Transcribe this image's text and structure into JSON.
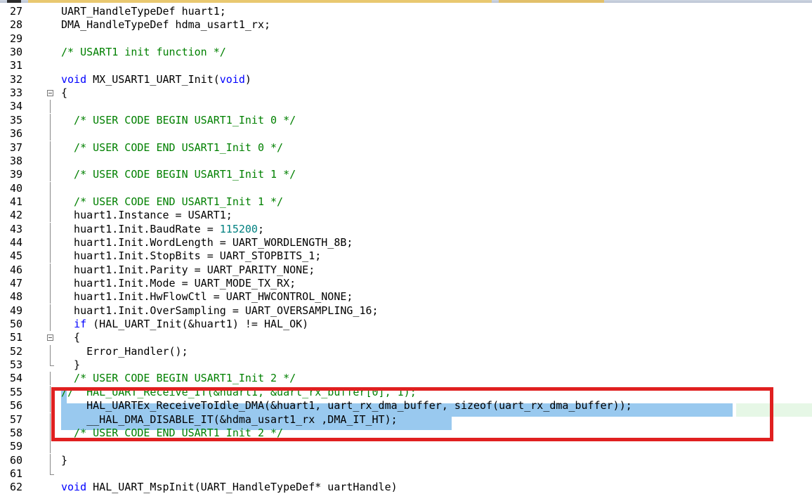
{
  "editor": {
    "lines": [
      {
        "n": "27",
        "parts": [
          {
            "t": "UART_HandleTypeDef huart1;",
            "c": "p"
          }
        ]
      },
      {
        "n": "28",
        "parts": [
          {
            "t": "DMA_HandleTypeDef hdma_usart1_rx;",
            "c": "p"
          }
        ]
      },
      {
        "n": "29",
        "parts": []
      },
      {
        "n": "30",
        "parts": [
          {
            "t": "/* USART1 init function */",
            "c": "cm"
          }
        ]
      },
      {
        "n": "31",
        "parts": []
      },
      {
        "n": "32",
        "parts": [
          {
            "t": "void",
            "c": "kw"
          },
          {
            "t": " MX_USART1_UART_Init(",
            "c": "p"
          },
          {
            "t": "void",
            "c": "kw"
          },
          {
            "t": ")",
            "c": "p"
          }
        ]
      },
      {
        "n": "33",
        "parts": [
          {
            "t": "{",
            "c": "p"
          }
        ]
      },
      {
        "n": "34",
        "parts": []
      },
      {
        "n": "35",
        "parts": [
          {
            "t": "  /* USER CODE BEGIN USART1_Init 0 */",
            "c": "cm"
          }
        ]
      },
      {
        "n": "36",
        "parts": []
      },
      {
        "n": "37",
        "parts": [
          {
            "t": "  /* USER CODE END USART1_Init 0 */",
            "c": "cm"
          }
        ]
      },
      {
        "n": "38",
        "parts": []
      },
      {
        "n": "39",
        "parts": [
          {
            "t": "  /* USER CODE BEGIN USART1_Init 1 */",
            "c": "cm"
          }
        ]
      },
      {
        "n": "40",
        "parts": []
      },
      {
        "n": "41",
        "parts": [
          {
            "t": "  /* USER CODE END USART1_Init 1 */",
            "c": "cm"
          }
        ]
      },
      {
        "n": "42",
        "parts": [
          {
            "t": "  huart1.Instance = USART1;",
            "c": "p"
          }
        ]
      },
      {
        "n": "43",
        "parts": [
          {
            "t": "  huart1.Init.BaudRate = ",
            "c": "p"
          },
          {
            "t": "115200",
            "c": "num"
          },
          {
            "t": ";",
            "c": "p"
          }
        ]
      },
      {
        "n": "44",
        "parts": [
          {
            "t": "  huart1.Init.WordLength = UART_WORDLENGTH_8B;",
            "c": "p"
          }
        ]
      },
      {
        "n": "45",
        "parts": [
          {
            "t": "  huart1.Init.StopBits = UART_STOPBITS_1;",
            "c": "p"
          }
        ]
      },
      {
        "n": "46",
        "parts": [
          {
            "t": "  huart1.Init.Parity = UART_PARITY_NONE;",
            "c": "p"
          }
        ]
      },
      {
        "n": "47",
        "parts": [
          {
            "t": "  huart1.Init.Mode = UART_MODE_TX_RX;",
            "c": "p"
          }
        ]
      },
      {
        "n": "48",
        "parts": [
          {
            "t": "  huart1.Init.HwFlowCtl = UART_HWCONTROL_NONE;",
            "c": "p"
          }
        ]
      },
      {
        "n": "49",
        "parts": [
          {
            "t": "  huart1.Init.OverSampling = UART_OVERSAMPLING_16;",
            "c": "p"
          }
        ]
      },
      {
        "n": "50",
        "parts": [
          {
            "t": "  ",
            "c": "p"
          },
          {
            "t": "if",
            "c": "kw"
          },
          {
            "t": " (HAL_UART_Init(&huart1) != HAL_OK)",
            "c": "p"
          }
        ]
      },
      {
        "n": "51",
        "parts": [
          {
            "t": "  {",
            "c": "p"
          }
        ]
      },
      {
        "n": "52",
        "parts": [
          {
            "t": "    Error_Handler();",
            "c": "p"
          }
        ]
      },
      {
        "n": "53",
        "parts": [
          {
            "t": "  }",
            "c": "p"
          }
        ]
      },
      {
        "n": "54",
        "parts": [
          {
            "t": "  /* USER CODE BEGIN USART1_Init 2 */",
            "c": "cm"
          }
        ]
      },
      {
        "n": "55",
        "parts": [
          {
            "t": "//  HAL_UART_Receive_IT(&huart1, &uart_rx_buffer[0], 1);",
            "c": "cm"
          }
        ]
      },
      {
        "n": "56",
        "parts": [
          {
            "t": "    HAL_UARTEx_ReceiveToIdle_DMA(&huart1, uart_rx_dma_buffer, sizeof(uart_rx_dma_buffer));",
            "c": "p"
          }
        ]
      },
      {
        "n": "57",
        "parts": [
          {
            "t": "    __HAL_DMA_DISABLE_IT(&hdma_usart1_rx ,DMA_IT_HT);",
            "c": "p"
          }
        ]
      },
      {
        "n": "58",
        "parts": [
          {
            "t": "  /* USER CODE END USART1_Init 2 */",
            "c": "cm"
          }
        ]
      },
      {
        "n": "59",
        "parts": []
      },
      {
        "n": "60",
        "parts": [
          {
            "t": "}",
            "c": "p"
          }
        ]
      },
      {
        "n": "61",
        "parts": []
      },
      {
        "n": "62",
        "parts": [
          {
            "t": "void",
            "c": "kw"
          },
          {
            "t": " HAL_UART_MspInit(UART_HandleTypeDef* uartHandle)",
            "c": "p"
          }
        ]
      }
    ]
  },
  "colors": {
    "keyword": "#0000ff",
    "comment": "#008000",
    "number": "#008080",
    "selection": "#99c9ef",
    "annotation_box": "#e02020"
  }
}
